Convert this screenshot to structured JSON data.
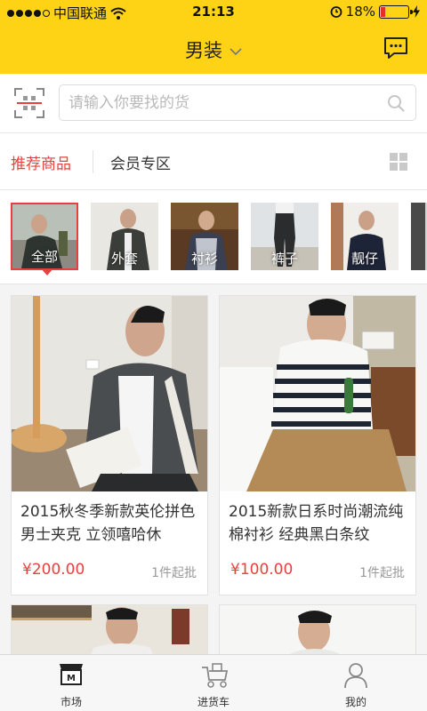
{
  "status_bar": {
    "carrier": "中国联通",
    "time": "21:13",
    "battery": "18%",
    "battery_level": 0.18
  },
  "nav": {
    "title": "男装"
  },
  "search": {
    "placeholder": "请输入你要找的货"
  },
  "tabs": {
    "recommended": "推荐商品",
    "members": "会员专区"
  },
  "categories": [
    {
      "label": "全部",
      "selected": true
    },
    {
      "label": "外套",
      "selected": false
    },
    {
      "label": "衬衫",
      "selected": false
    },
    {
      "label": "裤子",
      "selected": false
    },
    {
      "label": "靓仔",
      "selected": false
    }
  ],
  "products": [
    {
      "name": "2015秋冬季新款英伦拼色男士夹克 立领嘻哈休",
      "price": "¥200.00",
      "moq": "1件起批"
    },
    {
      "name": "2015新款日系时尚潮流纯棉衬衫 经典黑白条纹",
      "price": "¥100.00",
      "moq": "1件起批"
    }
  ],
  "tabbar": {
    "market": "市场",
    "cart": "进货车",
    "mine": "我的"
  },
  "colors": {
    "accent_yellow": "#ffd315",
    "accent_red": "#e8413d"
  }
}
